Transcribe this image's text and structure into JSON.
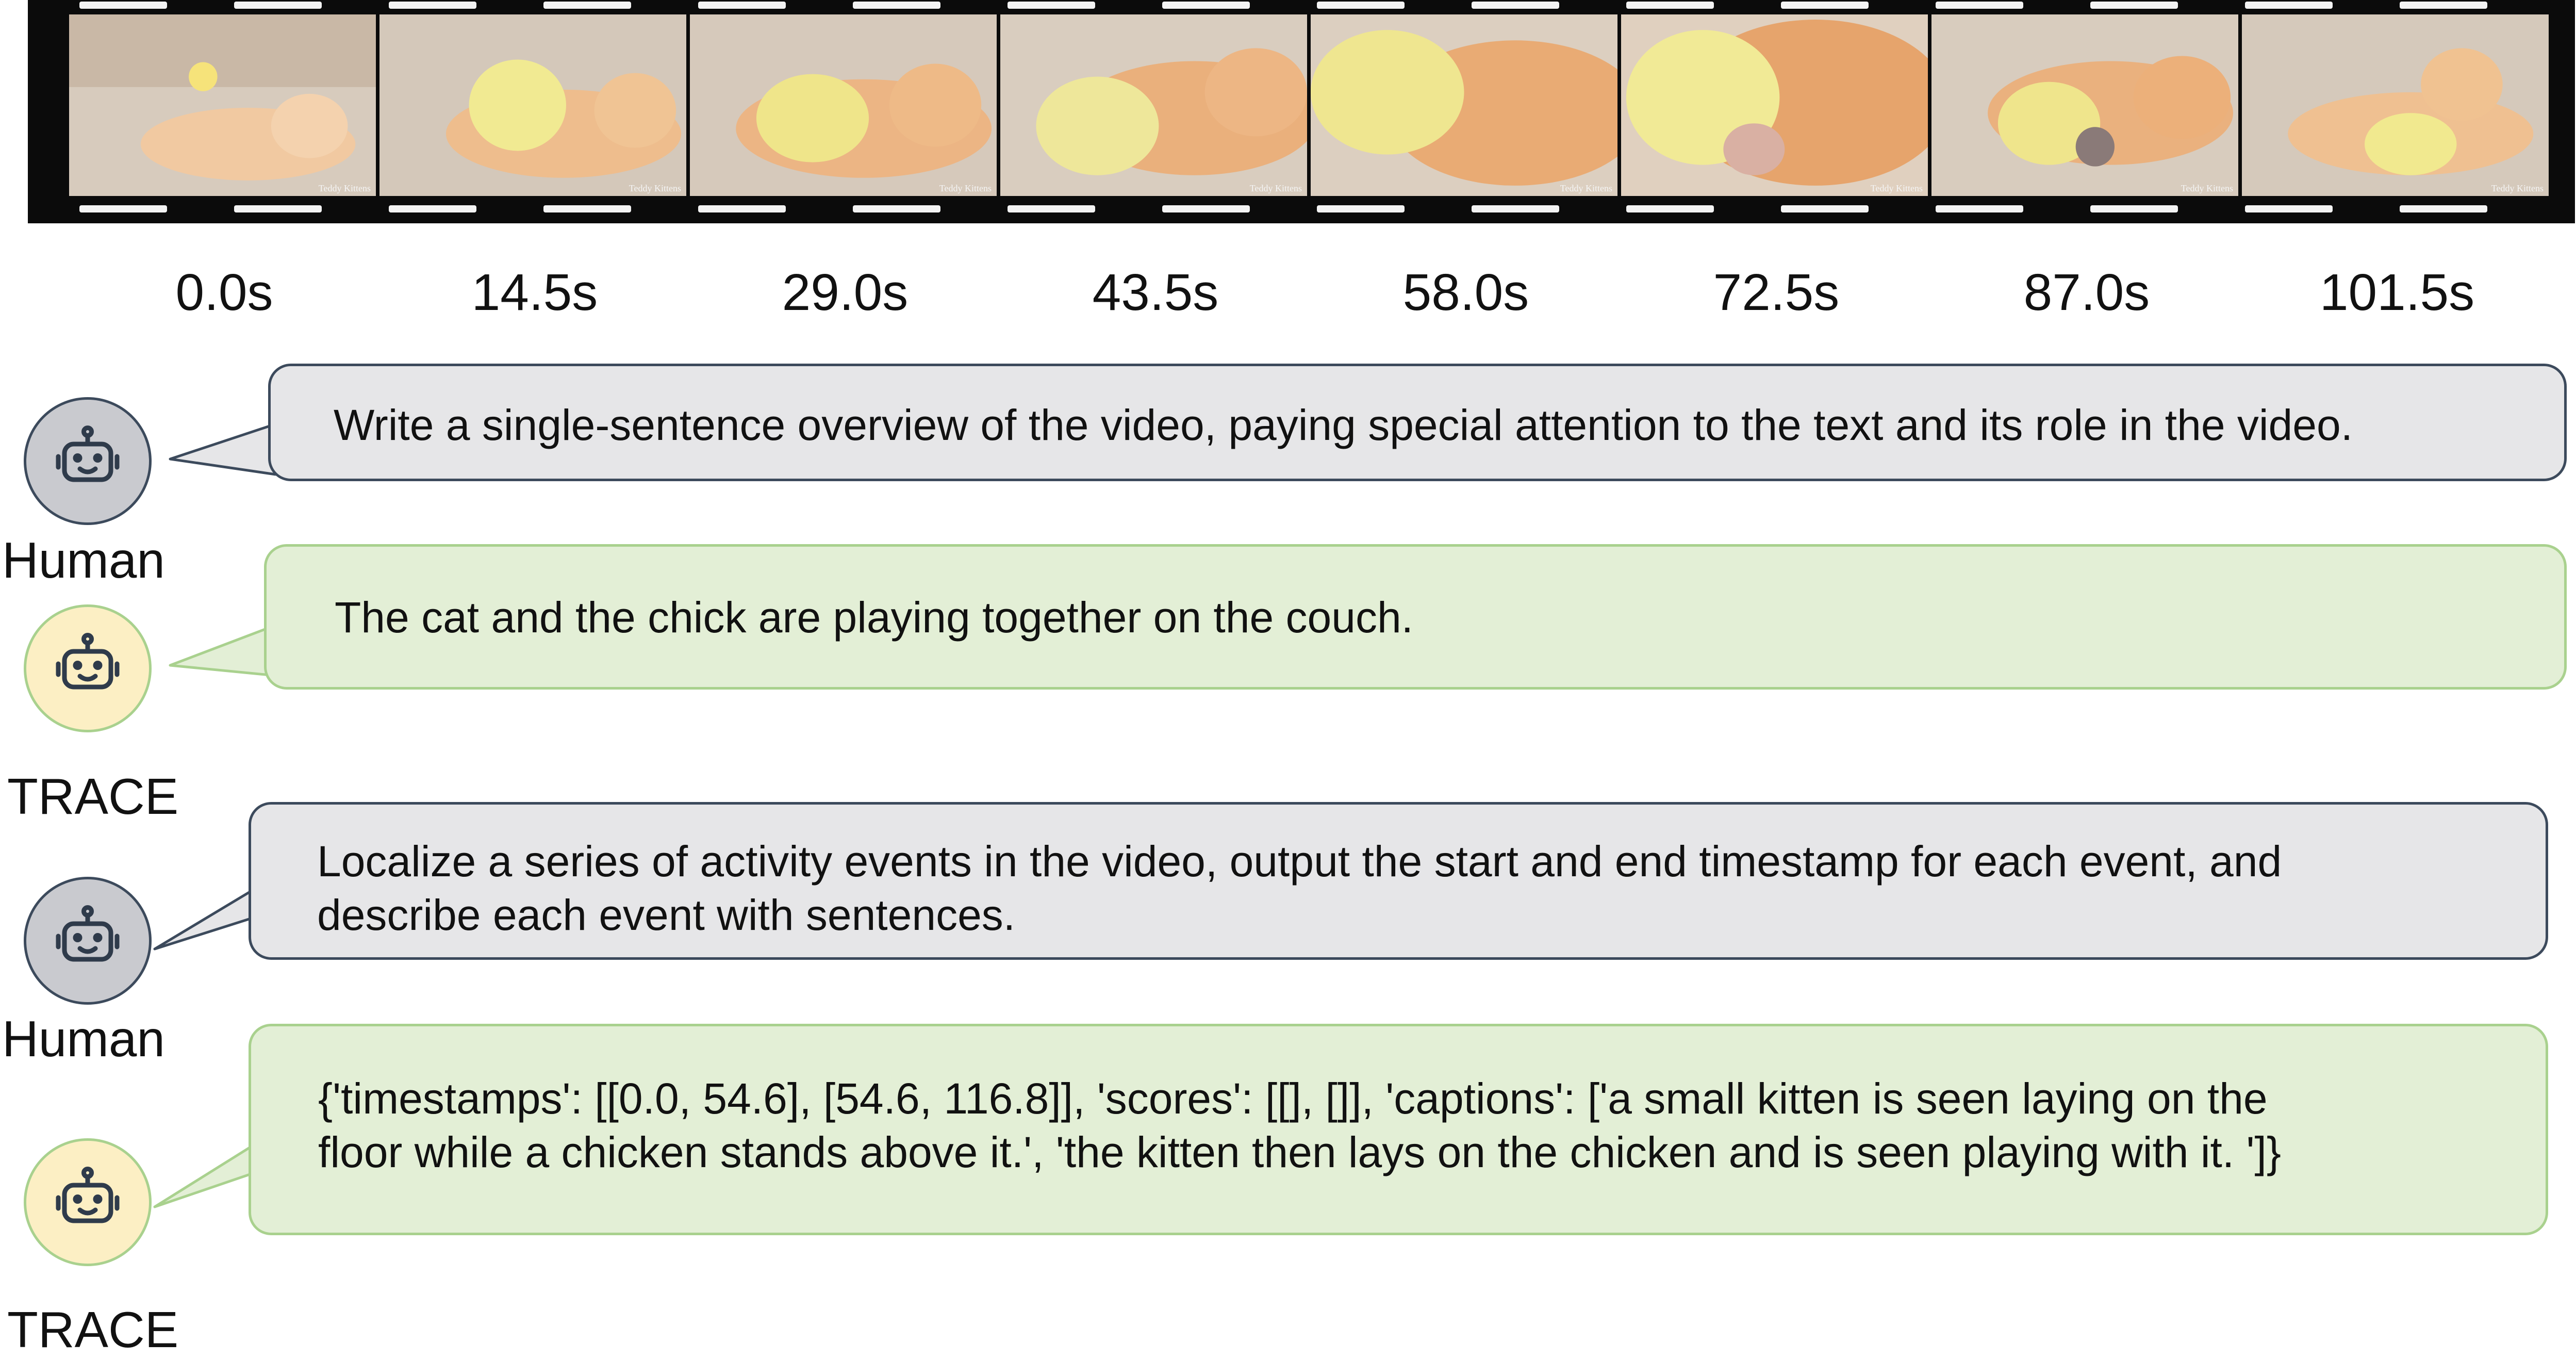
{
  "timeline": {
    "labels": [
      "0.0s",
      "14.5s",
      "29.0s",
      "43.5s",
      "58.0s",
      "72.5s",
      "87.0s",
      "101.5s"
    ],
    "watermark": "Teddy Kittens"
  },
  "colors": {
    "human_bubble_fill": "#e6e6e8",
    "human_bubble_border": "#3c4a5c",
    "trace_bubble_fill": "#e3efd6",
    "trace_bubble_border": "#a9d18e",
    "human_avatar_fill": "#c9cacf",
    "trace_avatar_fill": "#fcefc4"
  },
  "conversation": [
    {
      "role": "Human",
      "icon": "robot-icon",
      "text": "Write a single-sentence overview of the video, paying special attention to the text and its role in the video."
    },
    {
      "role": "TRACE",
      "icon": "robot-icon",
      "text": "The cat and the chick are playing together on the couch."
    },
    {
      "role": "Human",
      "icon": "robot-icon",
      "lines": [
        "Localize a series of activity events in the video, output the start and end timestamp for each event, and",
        "describe each event with sentences."
      ]
    },
    {
      "role": "TRACE",
      "icon": "robot-icon",
      "lines": [
        "{'timestamps': [[0.0, 54.6], [54.6, 116.8]], 'scores': [[], []], 'captions': ['a small kitten is seen laying on the",
        "floor while a chicken stands above it.', 'the kitten then lays on the chicken and is seen playing with it. ']}"
      ]
    }
  ]
}
